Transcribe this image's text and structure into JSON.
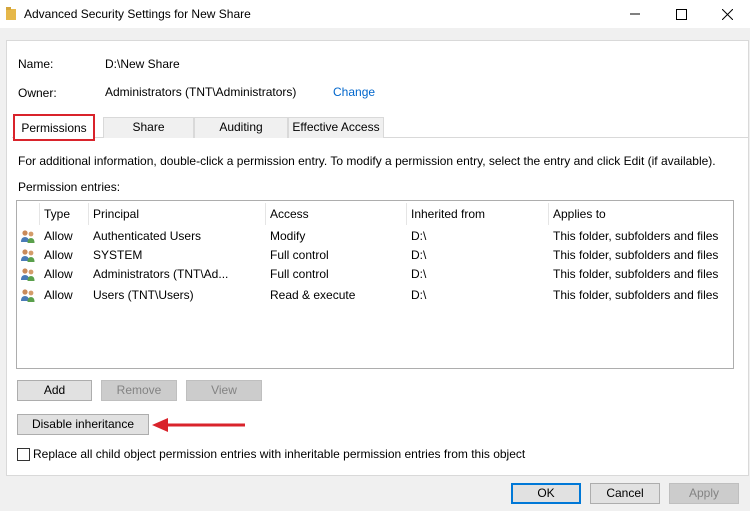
{
  "window": {
    "title": "Advanced Security Settings for New Share",
    "controls": [
      "minimize-icon",
      "maximize-icon",
      "close-icon"
    ]
  },
  "details": {
    "name_label": "Name:",
    "name_value": "D:\\New Share",
    "owner_label": "Owner:",
    "owner_value": "Administrators (TNT\\Administrators)",
    "change_link": "Change"
  },
  "tabs": [
    {
      "label": "Permissions",
      "active": true
    },
    {
      "label": "Share",
      "active": false
    },
    {
      "label": "Auditing",
      "active": false
    },
    {
      "label": "Effective Access",
      "active": false
    }
  ],
  "info_text": "For additional information, double-click a permission entry. To modify a permission entry, select the entry and click Edit (if available).",
  "entries_label": "Permission entries:",
  "table": {
    "columns": [
      "Type",
      "Principal",
      "Access",
      "Inherited from",
      "Applies to"
    ],
    "rows": [
      {
        "type": "Allow",
        "principal": "Authenticated Users",
        "access": "Modify",
        "inherited": "D:\\",
        "applies": "This folder, subfolders and files"
      },
      {
        "type": "Allow",
        "principal": "SYSTEM",
        "access": "Full control",
        "inherited": "D:\\",
        "applies": "This folder, subfolders and files"
      },
      {
        "type": "Allow",
        "principal": "Administrators (TNT\\Ad...",
        "access": "Full control",
        "inherited": "D:\\",
        "applies": "This folder, subfolders and files"
      },
      {
        "type": "Allow",
        "principal": "Users (TNT\\Users)",
        "access": "Read & execute",
        "inherited": "D:\\",
        "applies": "This folder, subfolders and files"
      }
    ]
  },
  "buttons": {
    "add": "Add",
    "remove": "Remove",
    "view": "View",
    "disable_inheritance": "Disable inheritance",
    "ok": "OK",
    "cancel": "Cancel",
    "apply": "Apply"
  },
  "checkbox": {
    "label": "Replace all child object permission entries with inheritable permission entries from this object",
    "checked": false
  },
  "colors": {
    "highlight_red": "#d9232b",
    "link_blue": "#0066cc",
    "focus_blue": "#0078d7"
  }
}
